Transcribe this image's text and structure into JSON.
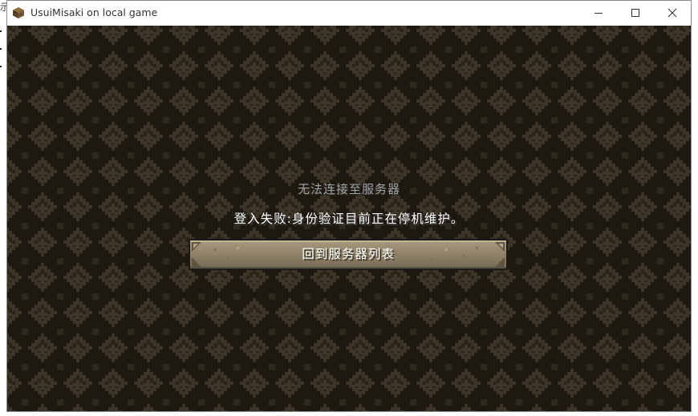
{
  "window": {
    "title": "UsuiMisaki on local game",
    "controls": {
      "minimize_icon": "minimize-icon",
      "maximize_icon": "maximize-icon",
      "close_icon": "close-icon"
    }
  },
  "desktop": {
    "edge_glyph": "示"
  },
  "screen": {
    "title": "无法连接至服务器",
    "message": "登入失败:身份验证目前正在停机维护。",
    "back_button": "回到服务器列表"
  },
  "colors": {
    "background_dark": "#1e1a12",
    "background_light": "#3a3326",
    "title_text": "#a0a0a0",
    "message_text": "#ffffff",
    "button_face": "#8e8168"
  }
}
